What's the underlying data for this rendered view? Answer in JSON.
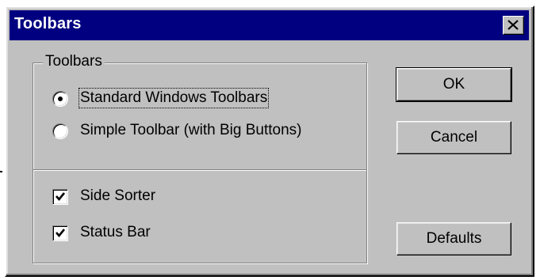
{
  "window": {
    "title": "Toolbars"
  },
  "title_bar": {
    "close_icon": "close-icon"
  },
  "group": {
    "legend": "Toolbars",
    "radio_options": [
      {
        "label": "Standard Windows Toolbars",
        "selected": true
      },
      {
        "label": "Simple Toolbar (with Big Buttons)",
        "selected": false
      }
    ],
    "checkboxes": [
      {
        "label": "Side Sorter",
        "checked": true
      },
      {
        "label": "Status Bar",
        "checked": true
      }
    ]
  },
  "buttons": {
    "ok": "OK",
    "cancel": "Cancel",
    "defaults": "Defaults"
  },
  "colors": {
    "titlebar": "#000080",
    "face": "#c0c0c0"
  }
}
